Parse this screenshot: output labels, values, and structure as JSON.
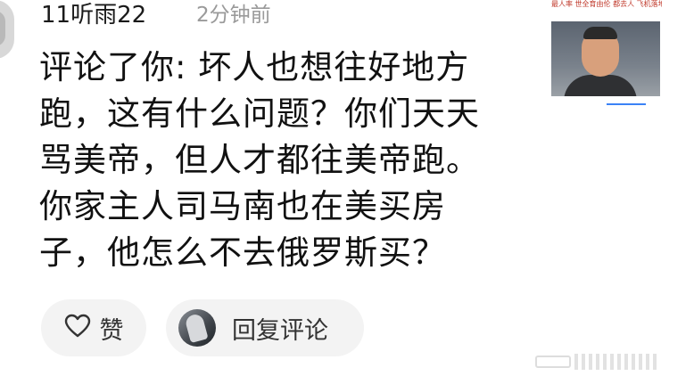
{
  "comment": {
    "username": "11听雨22",
    "timestamp": "2分钟前",
    "lines": [
      "评论了你: 坏人也想往好地方",
      "跑，这有什么问题？你们天天",
      "骂美帝，但人才都往美帝跑。",
      "你家主人司马南也在美买房",
      "子，他怎么不去俄罗斯买？"
    ]
  },
  "thumbnail": {
    "caption": "最人率 世全育由伦 都去人 飞机落地 已延大到门方向"
  },
  "actions": {
    "like_label": "赞",
    "reply_label": "回复评论"
  },
  "colors": {
    "text": "#111111",
    "muted": "#9a9a9a",
    "pill_bg": "#f3f3f3",
    "thumb_caption": "#c0392b"
  },
  "icons": {
    "like": "heart-outline-icon",
    "reply_avatar": "user-avatar"
  }
}
